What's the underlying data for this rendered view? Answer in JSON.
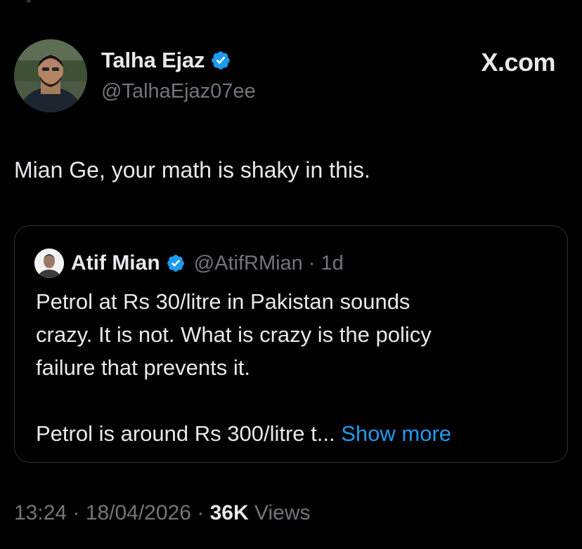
{
  "author": {
    "name": "Talha Ejaz",
    "handle": "@TalhaEjaz07ee"
  },
  "site_label": "X.com",
  "tweet": {
    "text": "Mian Ge, your math is shaky in this."
  },
  "quoted": {
    "name": "Atif Mian",
    "handle": "@AtifRMian",
    "separator": "·",
    "time": "1d",
    "lines": [
      "Petrol at Rs 30/litre in Pakistan sounds",
      "crazy. It is not. What is crazy is the policy",
      "failure that prevents it."
    ],
    "truncated_line": "Petrol is around Rs 300/litre t...",
    "show_more": "Show more"
  },
  "meta": {
    "time": "13:24",
    "sep1": "·",
    "date": "18/04/2026",
    "sep2": "·",
    "views_count": "36K",
    "views_label": "Views"
  },
  "colors": {
    "background": "#000000",
    "text": "#e7e9ea",
    "muted": "#71767b",
    "link": "#1d9bf0",
    "verified": "#1d9bf0",
    "border": "#2f3336"
  }
}
